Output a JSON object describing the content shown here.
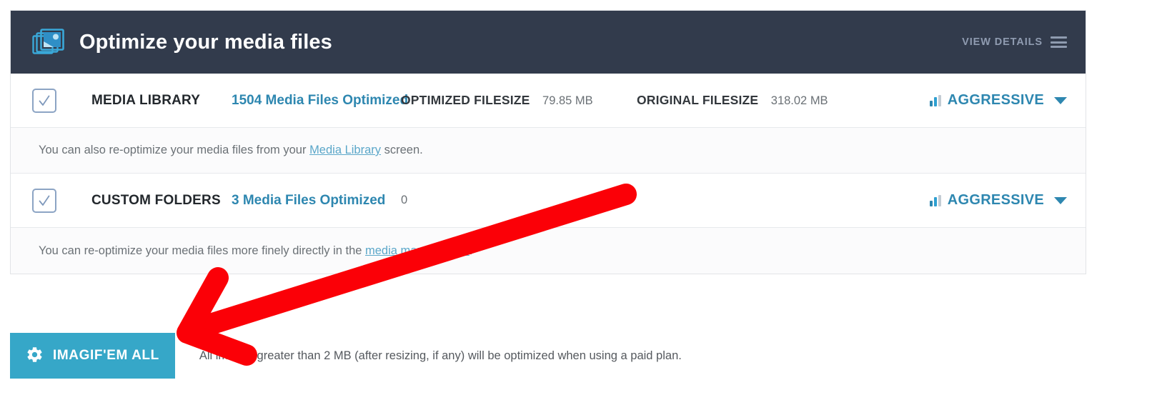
{
  "header": {
    "icon": "media-stack-icon",
    "title": "Optimize your media files",
    "view_details_label": "VIEW DETAILS",
    "menu_icon": "hamburger-icon",
    "background": "#323b4c",
    "title_color": "#ffffff",
    "link_color": "#8f9bb0"
  },
  "accent_colors": {
    "teal": "#36a7c8",
    "link_blue": "#2e87b0",
    "annotation_red": "#fb0007",
    "checkbox_border": "#8ca4c4"
  },
  "rows": [
    {
      "checkbox_state": "checked",
      "title": "MEDIA LIBRARY",
      "count_label": "1504 Media Files Optimized",
      "optimized_label": "OPTIMIZED FILESIZE",
      "optimized_value": "79.85 MB",
      "original_label": "ORIGINAL FILESIZE",
      "original_value": "318.02 MB",
      "level_label": "AGGRESSIVE",
      "level_icon": "bar-levels-icon",
      "caret_icon": "chevron-down-icon"
    },
    {
      "checkbox_state": "checked",
      "title": "CUSTOM FOLDERS",
      "count_label": "3 Media Files Optimized",
      "optimized_label": "",
      "optimized_value": "0",
      "original_label": "",
      "original_value": "",
      "level_label": "AGGRESSIVE",
      "level_icon": "bar-levels-icon",
      "caret_icon": "chevron-down-icon"
    }
  ],
  "notes": {
    "media_library": {
      "before_link": "You can also re-optimize your media files from your ",
      "link": "Media Library",
      "after_link": " screen."
    },
    "custom_folders": {
      "before_link": "You can re-optimize your media files more finely directly in the ",
      "link": "media management",
      "after_link": "."
    }
  },
  "footer": {
    "button_label": "IMAGIF'EM ALL",
    "button_icon": "gear-icon",
    "note": "All images greater than 2 MB (after resizing, if any) will be optimized when using a paid plan."
  },
  "annotation": {
    "type": "arrow",
    "color": "#fb0007",
    "from": "885,270",
    "to": "262,466"
  }
}
